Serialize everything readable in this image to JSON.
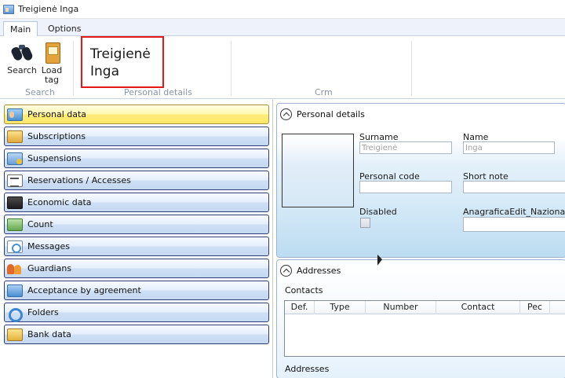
{
  "window": {
    "title": "Treigienė Inga"
  },
  "ribbon": {
    "tabs": [
      {
        "label": "Main",
        "active": true
      },
      {
        "label": "Options",
        "active": false
      }
    ],
    "buttons": [
      {
        "label_line1": "Search",
        "label_line2": "",
        "icon": "binoculars-icon"
      },
      {
        "label_line1": "Load",
        "label_line2": "tag",
        "icon": "tag-icon"
      }
    ],
    "groups": [
      "Search",
      "Personal details",
      "Crm"
    ],
    "person_name_line1": "Treigienė",
    "person_name_line2": "Inga"
  },
  "nav": {
    "items": [
      {
        "label": "Personal data",
        "icon": "person-card-icon",
        "selected": true
      },
      {
        "label": "Subscriptions",
        "icon": "ticket-icon",
        "selected": false
      },
      {
        "label": "Suspensions",
        "icon": "suspension-icon",
        "selected": false
      },
      {
        "label": "Reservations / Accesses",
        "icon": "list-icon",
        "selected": false
      },
      {
        "label": "Economic data",
        "icon": "wallet-icon",
        "selected": false
      },
      {
        "label": "Count",
        "icon": "money-icon",
        "selected": false
      },
      {
        "label": "Messages",
        "icon": "message-icon",
        "selected": false
      },
      {
        "label": "Guardians",
        "icon": "guardians-icon",
        "selected": false
      },
      {
        "label": "Acceptance by agreement",
        "icon": "agreement-icon",
        "selected": false
      },
      {
        "label": "Folders",
        "icon": "folder-icon",
        "selected": false
      },
      {
        "label": "Bank data",
        "icon": "bank-icon",
        "selected": false
      }
    ]
  },
  "personal": {
    "title": "Personal details",
    "surname_label": "Surname",
    "surname_value": "Treigienė",
    "name_label": "Name",
    "name_value": "Inga",
    "personal_code_label": "Personal code",
    "personal_code_value": "",
    "short_note_label": "Short note",
    "short_note_value": "",
    "disabled_label": "Disabled",
    "disabled_checked": false,
    "nationality_label": "AnagraficaEdit_Nazionalità",
    "nationality_value": ""
  },
  "addresses": {
    "title": "Addresses",
    "contacts_label": "Contacts",
    "columns": [
      "Def.",
      "Type",
      "Number",
      "Contact",
      "Pec"
    ],
    "addresses_label": "Addresses"
  },
  "colors": {
    "accent_red": "#e51818",
    "nav_border": "#2c3d77",
    "nav_selected": "#fff7b0"
  }
}
